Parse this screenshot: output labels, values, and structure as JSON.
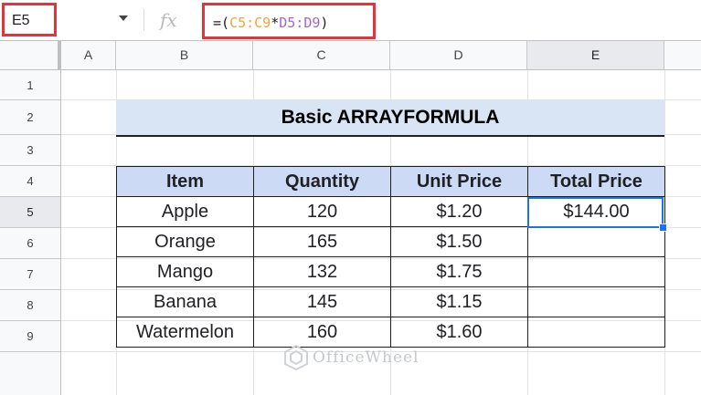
{
  "formula_bar": {
    "name_box": "E5",
    "fx_icon": "fx-icon",
    "formula_parts": [
      {
        "text": "=(",
        "kind": "plain"
      },
      {
        "text": "C5:C9",
        "kind": "range_a"
      },
      {
        "text": "*",
        "kind": "plain"
      },
      {
        "text": "D5:D9",
        "kind": "range_b"
      },
      {
        "text": ")",
        "kind": "plain"
      }
    ]
  },
  "columns": [
    "A",
    "B",
    "C",
    "D",
    "E"
  ],
  "selected_column": "E",
  "rows": [
    "1",
    "2",
    "3",
    "4",
    "5",
    "6",
    "7",
    "8",
    "9"
  ],
  "selected_row": "5",
  "title": "Basic ARRAYFORMULA",
  "table": {
    "headers": [
      "Item",
      "Quantity",
      "Unit Price",
      "Total Price"
    ],
    "rows": [
      [
        "Apple",
        "120",
        "$1.20",
        "$144.00"
      ],
      [
        "Orange",
        "165",
        "$1.50",
        ""
      ],
      [
        "Mango",
        "132",
        "$1.75",
        ""
      ],
      [
        "Banana",
        "145",
        "$1.15",
        ""
      ],
      [
        "Watermelon",
        "160",
        "$1.60",
        ""
      ]
    ]
  },
  "watermark": "OfficeWheel",
  "colors": {
    "highlight": "#e0363b",
    "selection": "#1a73e8",
    "title_fill": "#d9e5f5",
    "header_fill": "#ccdaf5"
  }
}
